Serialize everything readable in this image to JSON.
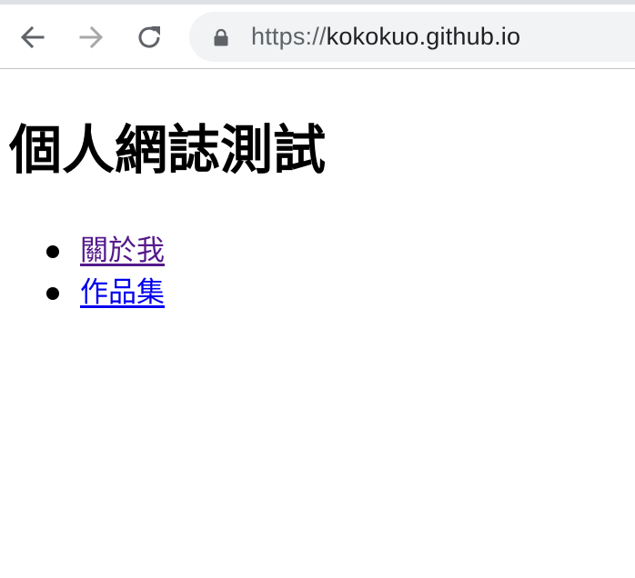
{
  "browser": {
    "url_scheme": "https://",
    "url_host": "kokokuo.github.io",
    "colors": {
      "toolbar_bg": "#ffffff",
      "omnibox_bg": "#f1f3f4",
      "icon_active": "#5f6368",
      "icon_disabled": "#a8a8a8"
    },
    "icons": {
      "back": "arrow-left-icon",
      "forward": "arrow-right-icon",
      "reload": "reload-icon",
      "lock": "lock-icon"
    }
  },
  "page": {
    "title": "個人網誌測試",
    "links": [
      {
        "label": "關於我",
        "state": "visited",
        "color": "#551a8b"
      },
      {
        "label": "作品集",
        "state": "unvisited",
        "color": "#0000ee"
      }
    ]
  }
}
